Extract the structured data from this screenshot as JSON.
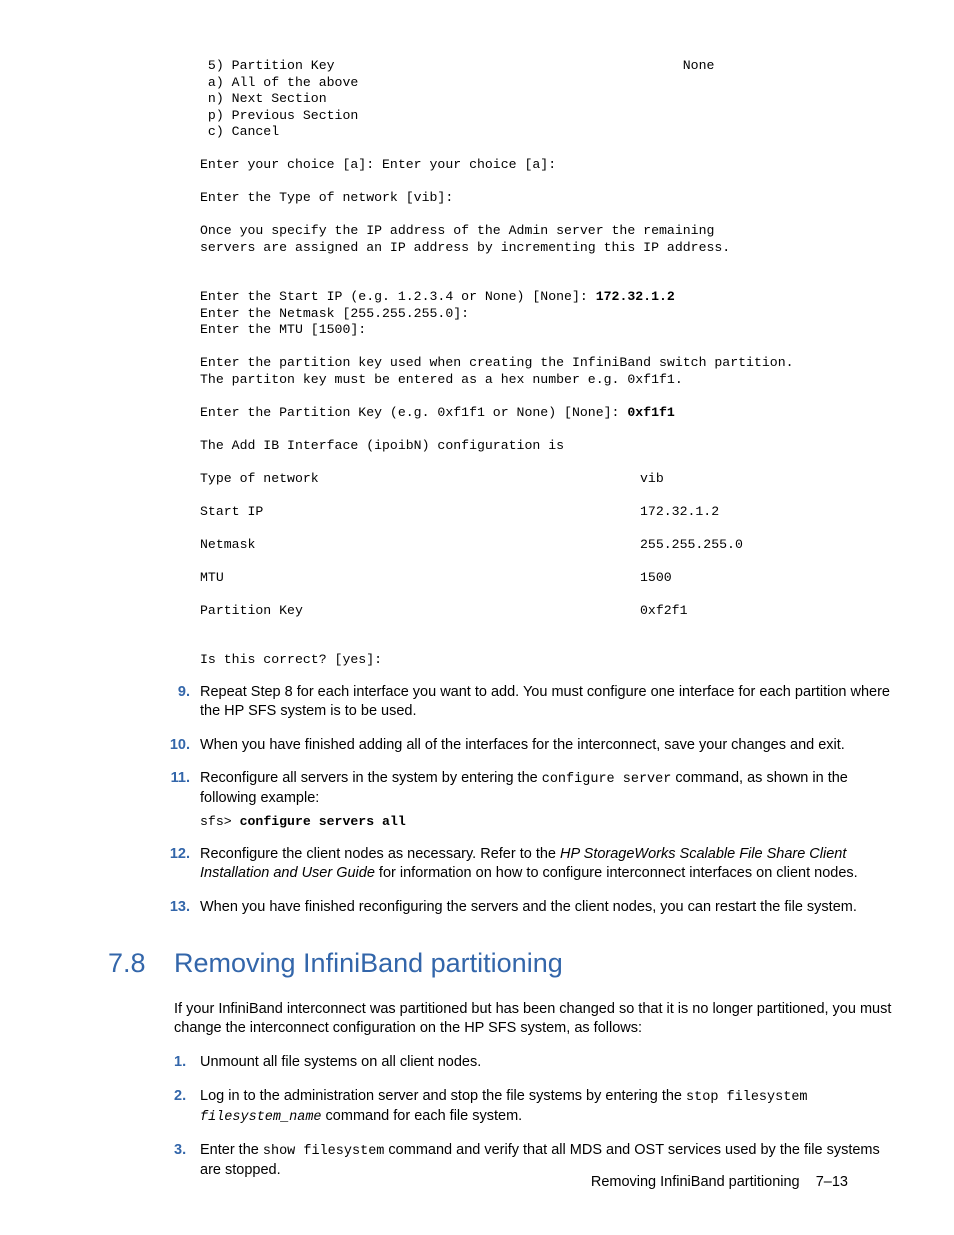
{
  "pre": {
    "l1": " 5) Partition Key                                            None",
    "l2": " a) All of the above",
    "l3": " n) Next Section",
    "l4": " p) Previous Section",
    "l5": " c) Cancel",
    "blank1": "",
    "l6": "Enter your choice [a]: Enter your choice [a]:",
    "blank2": "",
    "l7": "Enter the Type of network [vib]:",
    "blank3": "",
    "l8": "Once you specify the IP address of the Admin server the remaining",
    "l9": "servers are assigned an IP address by incrementing this IP address.",
    "blank4": "",
    "blank4b": "",
    "l10a": "Enter the Start IP (e.g. 1.2.3.4 or None) [None]: ",
    "l10b": "172.32.1.2",
    "l11": "Enter the Netmask [255.255.255.0]:",
    "l12": "Enter the MTU [1500]:",
    "blank5": "",
    "l13": "Enter the partition key used when creating the InfiniBand switch partition.",
    "l14": "The partiton key must be entered as a hex number e.g. 0xf1f1.",
    "blank6": "",
    "l15a": "Enter the Partition Key (e.g. 0xf1f1 or None) [None]: ",
    "l15b": "0xf1f1",
    "blank7": "",
    "l16": "The Add IB Interface (ipoibN) configuration is",
    "blank8": "",
    "r1a": "Type of network",
    "r1b": "vib",
    "r2a": "Start IP",
    "r2b": "172.32.1.2",
    "r3a": "Netmask",
    "r3b": "255.255.255.0",
    "r4a": "MTU",
    "r4b": "1500",
    "r5a": "Partition Key",
    "r5b": "0xf2f1",
    "blank9": "",
    "l22": "Is this correct? [yes]:"
  },
  "steps": {
    "s9num": "9.",
    "s9": "Repeat Step 8 for each interface you want to add. You must configure one interface for each partition where the HP SFS system is to be used.",
    "s10num": "10.",
    "s10": "When you have finished adding all of the interfaces for the interconnect, save your changes and exit.",
    "s11num": "11.",
    "s11a": "Reconfigure all servers in the system by entering the ",
    "s11code": "configure server",
    "s11b": " command, as shown in the following example:",
    "s11cmd_prompt": "sfs> ",
    "s11cmd_bold": "configure servers all",
    "s12num": "12.",
    "s12a": "Reconfigure the client nodes as necessary. Refer to the ",
    "s12i": "HP StorageWorks Scalable File Share Client Installation and User Guide",
    "s12b": " for information on how to configure interconnect interfaces on client nodes.",
    "s13num": "13.",
    "s13": "When you have finished reconfiguring the servers and the client nodes, you can restart the file system."
  },
  "section": {
    "num": "7.8",
    "title": "Removing InfiniBand partitioning",
    "intro": "If your InfiniBand interconnect was partitioned but has been changed so that it is no longer partitioned, you must change the interconnect configuration on the HP SFS system, as follows:"
  },
  "sub": {
    "s1num": "1.",
    "s1": "Unmount all file systems on all client nodes.",
    "s2num": "2.",
    "s2a": "Log in to the administration server and stop the file systems by entering the ",
    "s2code1": "stop filesystem ",
    "s2code2": "filesystem_name",
    "s2b": " command for each file system.",
    "s3num": "3.",
    "s3a": "Enter the ",
    "s3code": "show filesystem",
    "s3b": " command and verify that all MDS and OST services used by the file systems are stopped."
  },
  "footer": {
    "left": "Removing InfiniBand partitioning",
    "right": "7–13"
  }
}
